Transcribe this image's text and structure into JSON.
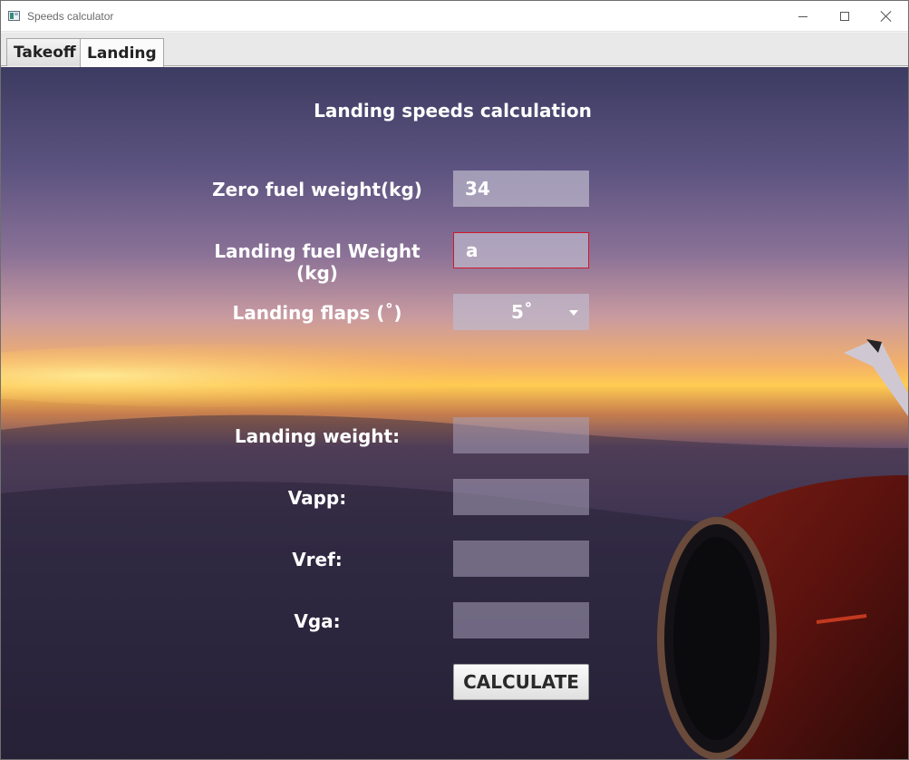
{
  "window": {
    "title": "Speeds calculator"
  },
  "tabs": [
    {
      "label": "Takeoff",
      "selected": false
    },
    {
      "label": "Landing",
      "selected": true
    }
  ],
  "form": {
    "heading": "Landing speeds calculation",
    "zero_fuel_weight": {
      "label": "Zero fuel weight(kg)",
      "value": "34"
    },
    "landing_fuel_weight": {
      "label": "Landing fuel Weight (kg)",
      "value": "a",
      "invalid": true
    },
    "landing_flaps": {
      "label": "Landing flaps (˚)",
      "value": "5˚"
    }
  },
  "results": {
    "landing_weight": {
      "label": "Landing weight:",
      "value": ""
    },
    "vapp": {
      "label": "Vapp:",
      "value": ""
    },
    "vref": {
      "label": "Vref:",
      "value": ""
    },
    "vga": {
      "label": "Vga:",
      "value": ""
    }
  },
  "actions": {
    "calculate_label": "CALCULATE"
  },
  "colors": {
    "invalid_border": "#d0192e",
    "button_text": "#2a2a2a"
  }
}
